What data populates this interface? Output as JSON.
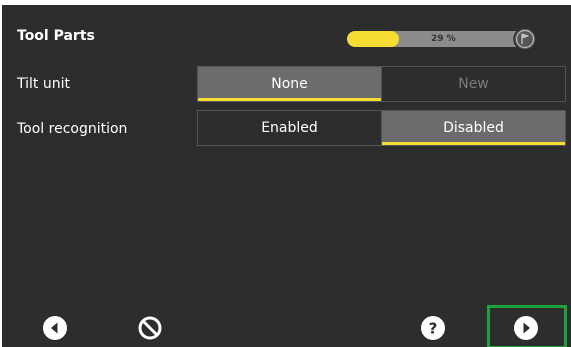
{
  "header": {
    "title": "Tool Parts",
    "progress": {
      "value_percent": 29,
      "label": "29 %"
    }
  },
  "rows": [
    {
      "label": "Tilt unit",
      "options": [
        "None",
        "New"
      ],
      "selected": "None"
    },
    {
      "label": "Tool recognition",
      "options": [
        "Enabled",
        "Disabled"
      ],
      "selected": "Disabled"
    }
  ],
  "footer": {
    "back_icon": "back-arrow-icon",
    "cancel_icon": "cancel-icon",
    "help_icon": "help-icon",
    "next_icon": "next-arrow-icon"
  },
  "colors": {
    "background": "#2d2d2d",
    "accent": "#f7dd32",
    "selected_option": "#6b6b6b",
    "highlight_green": "#1ca33c"
  }
}
